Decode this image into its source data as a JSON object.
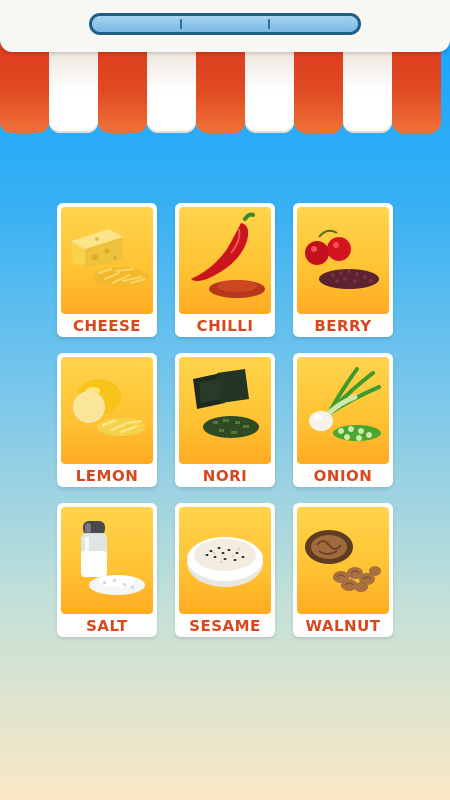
{
  "progress": {
    "fraction": 0.0,
    "segments": 3
  },
  "awning": {
    "colors": [
      "#e04a22",
      "#ffffff"
    ]
  },
  "ingredients": [
    {
      "label": "CHEESE",
      "icon": "cheese-icon"
    },
    {
      "label": "CHILLI",
      "icon": "chilli-icon"
    },
    {
      "label": "BERRY",
      "icon": "berry-icon"
    },
    {
      "label": "LEMON",
      "icon": "lemon-icon"
    },
    {
      "label": "NORI",
      "icon": "nori-icon"
    },
    {
      "label": "ONION",
      "icon": "onion-icon"
    },
    {
      "label": "SALT",
      "icon": "salt-icon"
    },
    {
      "label": "SESAME",
      "icon": "sesame-icon"
    },
    {
      "label": "WALNUT",
      "icon": "walnut-icon"
    }
  ],
  "colors": {
    "label": "#d8471d",
    "card_bg": "#ffc232",
    "progress_border": "#1d5d86"
  }
}
